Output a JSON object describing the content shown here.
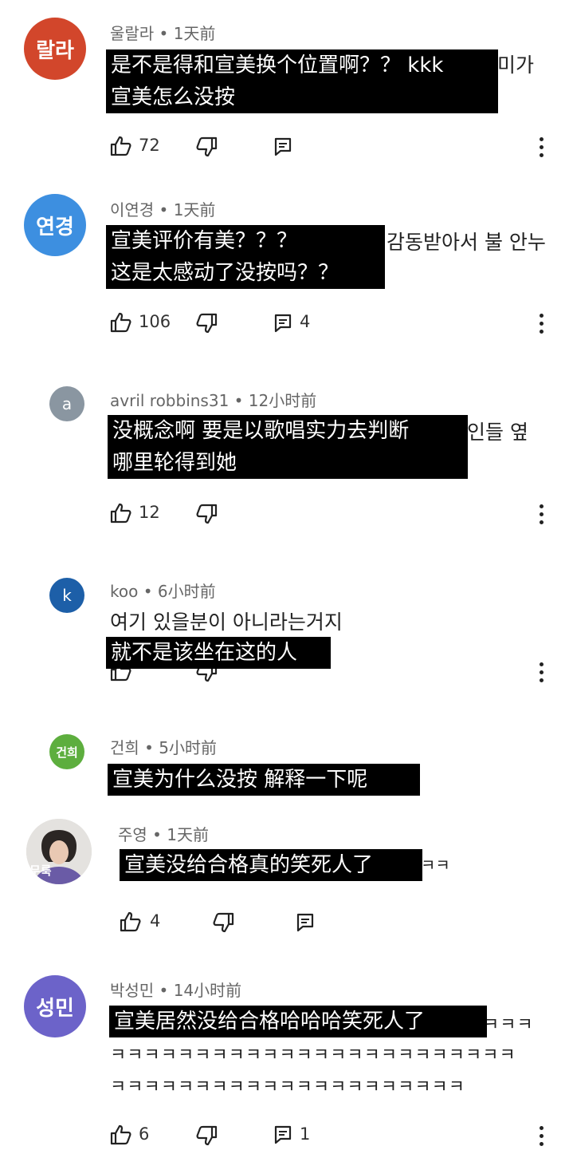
{
  "comments": [
    {
      "avatar_text": "랄라",
      "avatar_color": "#D2462B",
      "meta": "울랄라 • 1天前",
      "under_text": "미가",
      "subtitle": [
        "是不是得和宣美换个位置啊？？ kkk",
        "宣美怎么没按"
      ],
      "likes": "72",
      "replies": ""
    },
    {
      "avatar_text": "연경",
      "avatar_color": "#3D8FE0",
      "meta": "이연경 • 1天前",
      "under_text": "감동받아서 불 안누",
      "subtitle": [
        "宣美评价有美？？？",
        "这是太感动了没按吗？？"
      ],
      "likes": "106",
      "replies": "4"
    },
    {
      "avatar_text": "a",
      "avatar_color": "#8A96A1",
      "meta": "avril robbins31 • 12小时前",
      "under_text": "인들 옆",
      "subtitle": [
        "没概念啊 要是以歌唱实力去判断",
        "哪里轮得到她"
      ],
      "likes": "12",
      "replies": ""
    },
    {
      "avatar_text": "k",
      "avatar_color": "#1D5FA8",
      "meta": "koo • 6小时前",
      "under_text": "여기 있을분이 아니라는거지",
      "subtitle": [
        "就不是该坐在这的人"
      ],
      "likes": "",
      "replies": ""
    },
    {
      "avatar_text": "건희",
      "avatar_color": "#5DAE3E",
      "meta": "건희 • 5小时前",
      "under_text": "",
      "subtitle": [
        "宣美为什么没按 解释一下呢"
      ],
      "likes": "",
      "replies": ""
    },
    {
      "avatar_text": "무룩",
      "avatar_color": "#6A5BA6",
      "meta": "주영 • 1天前",
      "under_text": "ㅋㅋ",
      "subtitle": [
        "宣美没给合格真的笑死人了"
      ],
      "likes": "4",
      "replies": ""
    },
    {
      "avatar_text": "성민",
      "avatar_color": "#6C63C9",
      "meta": "박성민 • 14小时前",
      "under_text": "ㅋㅋㅋ",
      "under_lines": [
        "ㅋㅋㅋㅋㅋㅋㅋㅋㅋㅋㅋㅋㅋㅋㅋㅋㅋㅋㅋㅋㅋㅋㅋㅋ",
        "ㅋㅋㅋㅋㅋㅋㅋㅋㅋㅋㅋㅋㅋㅋㅋㅋㅋㅋㅋㅋㅋ"
      ],
      "subtitle": [
        "宣美居然没给合格哈哈哈笑死人了"
      ],
      "likes": "6",
      "replies": "1"
    }
  ],
  "icons": {
    "like": "thumbs-up-icon",
    "dislike": "thumbs-down-icon",
    "reply": "reply-icon",
    "more": "more-vertical-icon"
  }
}
